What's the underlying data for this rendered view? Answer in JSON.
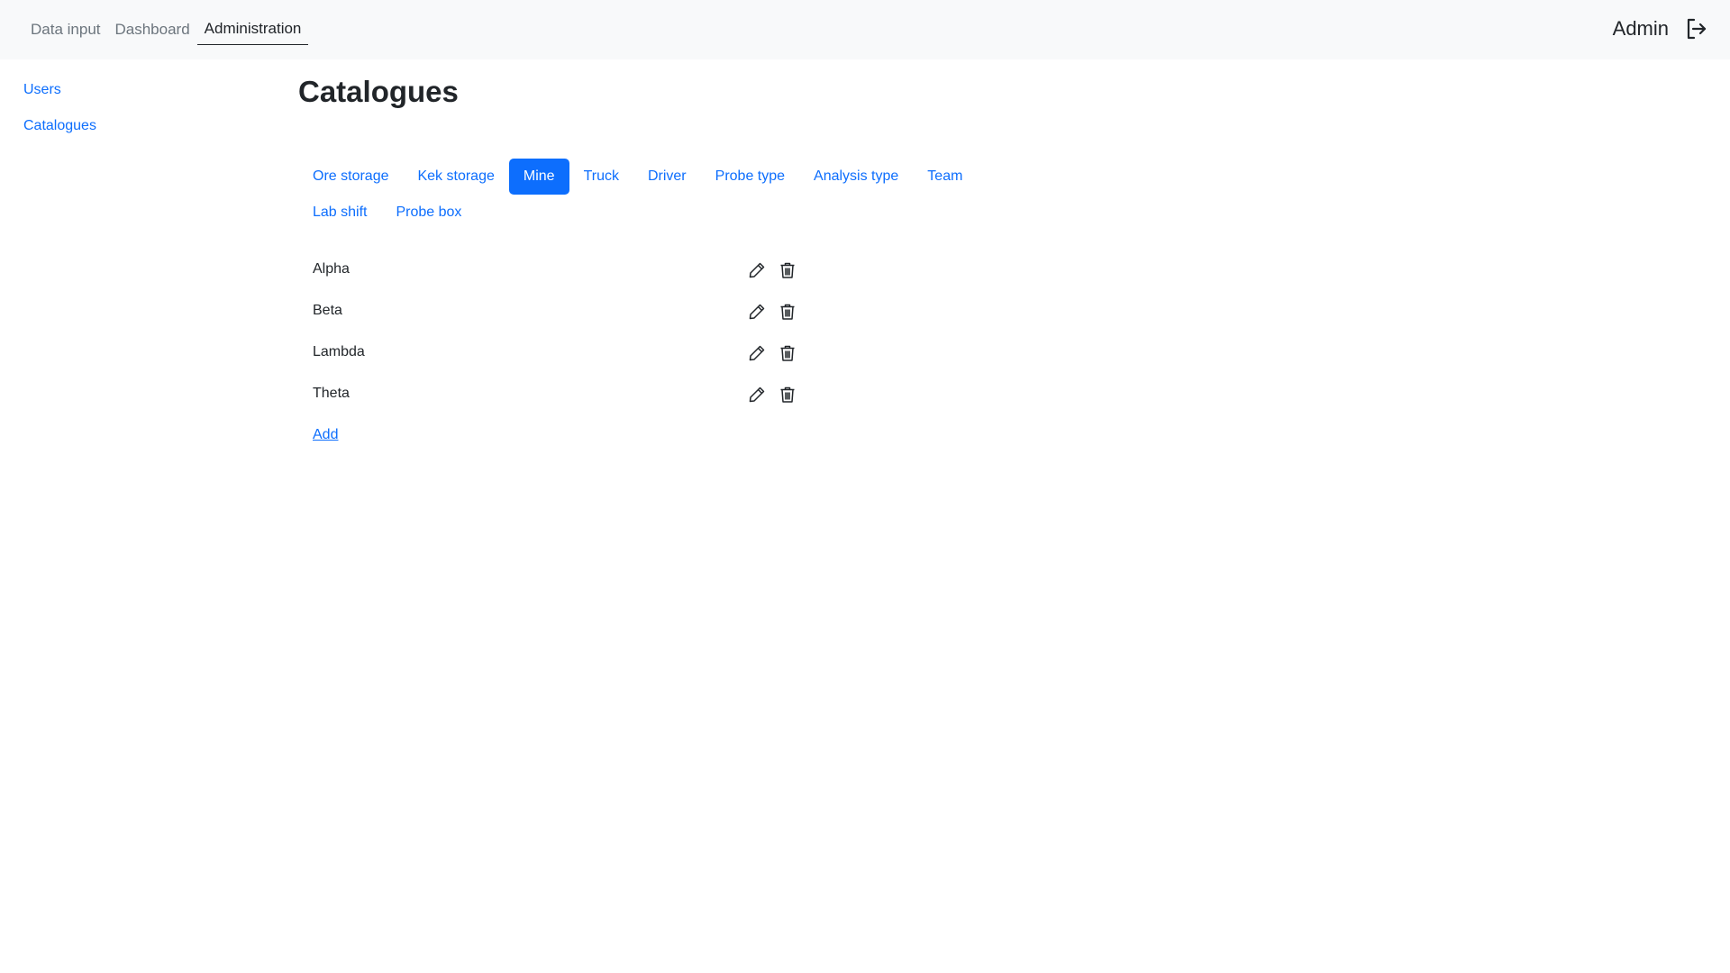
{
  "topnav": {
    "items": [
      {
        "label": "Data input"
      },
      {
        "label": "Dashboard"
      },
      {
        "label": "Administration",
        "active": true
      }
    ]
  },
  "user": {
    "name": "Admin",
    "logout_icon": "logout-icon"
  },
  "sidebar": {
    "items": [
      {
        "label": "Users"
      },
      {
        "label": "Catalogues"
      }
    ]
  },
  "page": {
    "title": "Catalogues"
  },
  "tabs": [
    {
      "label": "Ore storage"
    },
    {
      "label": "Kek storage"
    },
    {
      "label": "Mine",
      "active": true
    },
    {
      "label": "Truck"
    },
    {
      "label": "Driver"
    },
    {
      "label": "Probe type"
    },
    {
      "label": "Analysis type"
    },
    {
      "label": "Team"
    },
    {
      "label": "Lab shift"
    },
    {
      "label": "Probe box"
    }
  ],
  "items": [
    {
      "name": "Alpha"
    },
    {
      "name": "Beta"
    },
    {
      "name": "Lambda"
    },
    {
      "name": "Theta"
    }
  ],
  "actions": {
    "add_label": "Add",
    "edit_icon": "pencil-icon",
    "delete_icon": "trash-icon"
  },
  "colors": {
    "accent": "#0d6efd",
    "topbar_bg": "#f8f9fa",
    "text": "#212529",
    "muted": "#6c757d"
  }
}
